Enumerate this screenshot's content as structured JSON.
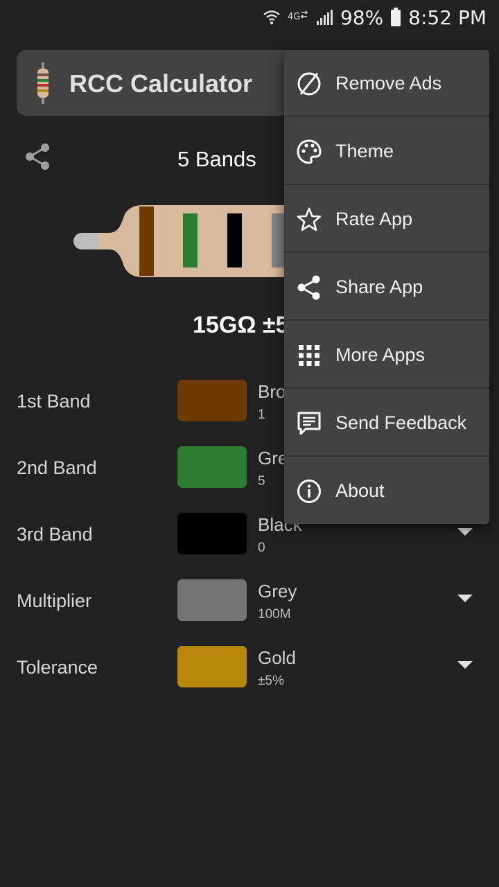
{
  "status_bar": {
    "battery": "98%",
    "time": "8:52 PM",
    "icons": [
      "wifi-icon",
      "4g-icon",
      "signal-icon",
      "battery-icon"
    ]
  },
  "toolbar": {
    "title": "RCC Calculator"
  },
  "main": {
    "bands_label": "5 Bands",
    "value_text": "15GΩ ±5",
    "resistor_band_colors": [
      "#6d3a00",
      "#2e7d32",
      "#000000",
      "#808080"
    ]
  },
  "bands": [
    {
      "label": "1st Band",
      "color_name": "Bro",
      "value": "1",
      "swatch": "#6d3a00"
    },
    {
      "label": "2nd Band",
      "color_name": "Gre",
      "value": "5",
      "swatch": "#2e7d32"
    },
    {
      "label": "3rd Band",
      "color_name": "Black",
      "value": "0",
      "swatch": "#000000"
    },
    {
      "label": "Multiplier",
      "color_name": "Grey",
      "value": "100M",
      "swatch": "#757575"
    },
    {
      "label": "Tolerance",
      "color_name": "Gold",
      "value": "±5%",
      "swatch": "#b8860b"
    }
  ],
  "menu": {
    "items": [
      {
        "label": "Remove Ads",
        "icon": "remove-ads-icon"
      },
      {
        "label": "Theme",
        "icon": "palette-icon"
      },
      {
        "label": "Rate App",
        "icon": "star-icon"
      },
      {
        "label": "Share App",
        "icon": "share-icon"
      },
      {
        "label": "More Apps",
        "icon": "grid-icon"
      },
      {
        "label": "Send Feedback",
        "icon": "feedback-icon"
      },
      {
        "label": "About",
        "icon": "info-icon"
      }
    ]
  },
  "colors": {
    "background": "#212121",
    "surface": "#424242",
    "resistor_body": "#d9b99b",
    "lead": "#bdbdbd"
  }
}
